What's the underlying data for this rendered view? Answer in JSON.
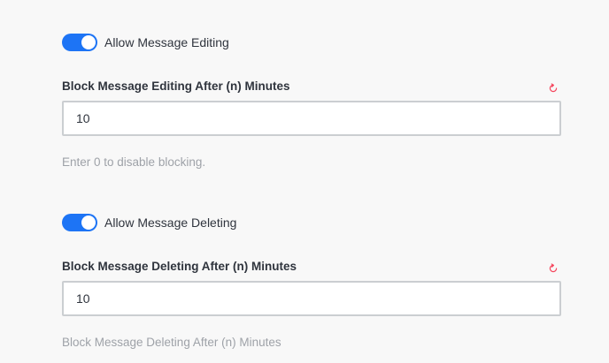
{
  "theme": {
    "accent": "#1d74f5",
    "reset_icon_color": "#f5455c"
  },
  "editing": {
    "toggle_label": "Allow Message Editing",
    "toggle_on": true,
    "field_label": "Block Message Editing After (n) Minutes",
    "value": "10",
    "hint": "Enter 0 to disable blocking.",
    "reset_icon": "reset-icon"
  },
  "deleting": {
    "toggle_label": "Allow Message Deleting",
    "toggle_on": true,
    "field_label": "Block Message Deleting After (n) Minutes",
    "value": "10",
    "hint": "Block Message Deleting After (n) Minutes",
    "reset_icon": "reset-icon"
  }
}
